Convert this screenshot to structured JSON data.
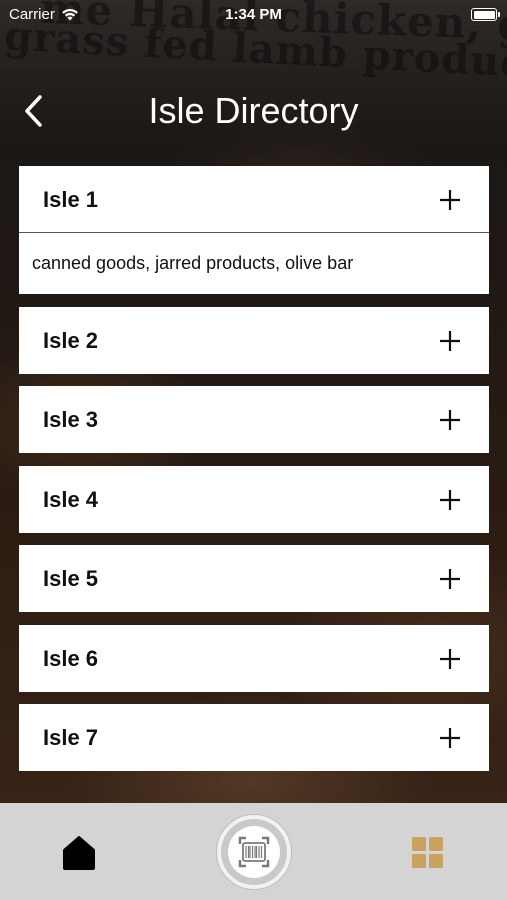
{
  "status_bar": {
    "carrier": "Carrier",
    "time": "1:34 PM"
  },
  "background": {
    "sign_line_1": "me Halal chicken, grass",
    "sign_line_2": "grass fed lamb products now"
  },
  "header": {
    "title": "Isle Directory"
  },
  "isles": [
    {
      "label": "Isle 1",
      "expanded": true,
      "detail": "canned goods, jarred products, olive bar"
    },
    {
      "label": "Isle 2",
      "expanded": false
    },
    {
      "label": "Isle 3",
      "expanded": false
    },
    {
      "label": "Isle 4",
      "expanded": false
    },
    {
      "label": "Isle 5",
      "expanded": false
    },
    {
      "label": "Isle 6",
      "expanded": false
    },
    {
      "label": "Isle 7",
      "expanded": false
    }
  ],
  "tabbar": {
    "home_icon": "home-icon",
    "scan_icon": "barcode-scan-icon",
    "grid_icon": "grid-icon",
    "active_color": "#000000",
    "grid_color": "#c9a25e"
  }
}
